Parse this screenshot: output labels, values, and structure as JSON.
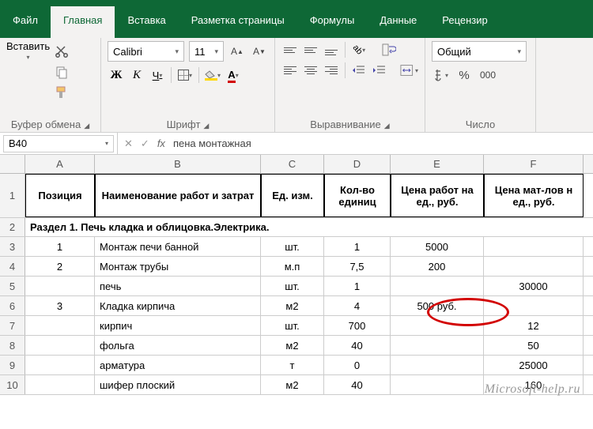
{
  "tabs": {
    "file": "Файл",
    "home": "Главная",
    "insert": "Вставка",
    "layout": "Разметка страницы",
    "formulas": "Формулы",
    "data": "Данные",
    "review": "Рецензир"
  },
  "ribbon": {
    "clipboard": {
      "paste": "Вставить",
      "label": "Буфер обмена"
    },
    "font": {
      "name": "Calibri",
      "size": "11",
      "label": "Шрифт",
      "bold": "Ж",
      "italic": "К",
      "underline": "Ч",
      "fontcolor": "А"
    },
    "align": {
      "label": "Выравнивание"
    },
    "number": {
      "format": "Общий",
      "label": "Число",
      "pct": "%",
      "sep": "000"
    }
  },
  "namebox": "B40",
  "formula": "пена монтажная",
  "cancel": "✕",
  "accept": "✓",
  "fx": "fx",
  "cols": {
    "A": "A",
    "B": "B",
    "C": "C",
    "D": "D",
    "E": "E",
    "F": "F"
  },
  "headers": {
    "pos": "Позиция",
    "name": "Наименование работ и затрат",
    "unit": "Ед. изм.",
    "qty": "Кол-во единиц",
    "priceWork": "Цена работ на ед., руб.",
    "priceMat": "Цена мат-лов н ед., руб."
  },
  "section": "Раздел 1. Печь кладка и облицовка.Электрика.",
  "rows": [
    {
      "n": "3",
      "pos": "1",
      "name": "Монтаж печи банной",
      "unit": "шт.",
      "qty": "1",
      "pw": "5000",
      "pm": ""
    },
    {
      "n": "4",
      "pos": "2",
      "name": "Монтаж трубы",
      "unit": "м.п",
      "qty": "7,5",
      "pw": "200",
      "pm": ""
    },
    {
      "n": "5",
      "pos": "",
      "name": "печь",
      "unit": "шт.",
      "qty": "1",
      "pw": "",
      "pm": "30000"
    },
    {
      "n": "6",
      "pos": "3",
      "name": "Кладка кирпича",
      "unit": "м2",
      "qty": "4",
      "pw": "500 руб.",
      "pm": ""
    },
    {
      "n": "7",
      "pos": "",
      "name": "кирпич",
      "unit": "шт.",
      "qty": "700",
      "pw": "",
      "pm": "12"
    },
    {
      "n": "8",
      "pos": "",
      "name": "фольга",
      "unit": "м2",
      "qty": "40",
      "pw": "",
      "pm": "50"
    },
    {
      "n": "9",
      "pos": "",
      "name": "арматура",
      "unit": "т",
      "qty": "0",
      "pw": "",
      "pm": "25000"
    },
    {
      "n": "10",
      "pos": "",
      "name": "шифер плоский",
      "unit": "м2",
      "qty": "40",
      "pw": "",
      "pm": "160"
    }
  ],
  "rowhead1": "1",
  "rowhead2": "2",
  "watermark": "Microsoft-help.ru"
}
